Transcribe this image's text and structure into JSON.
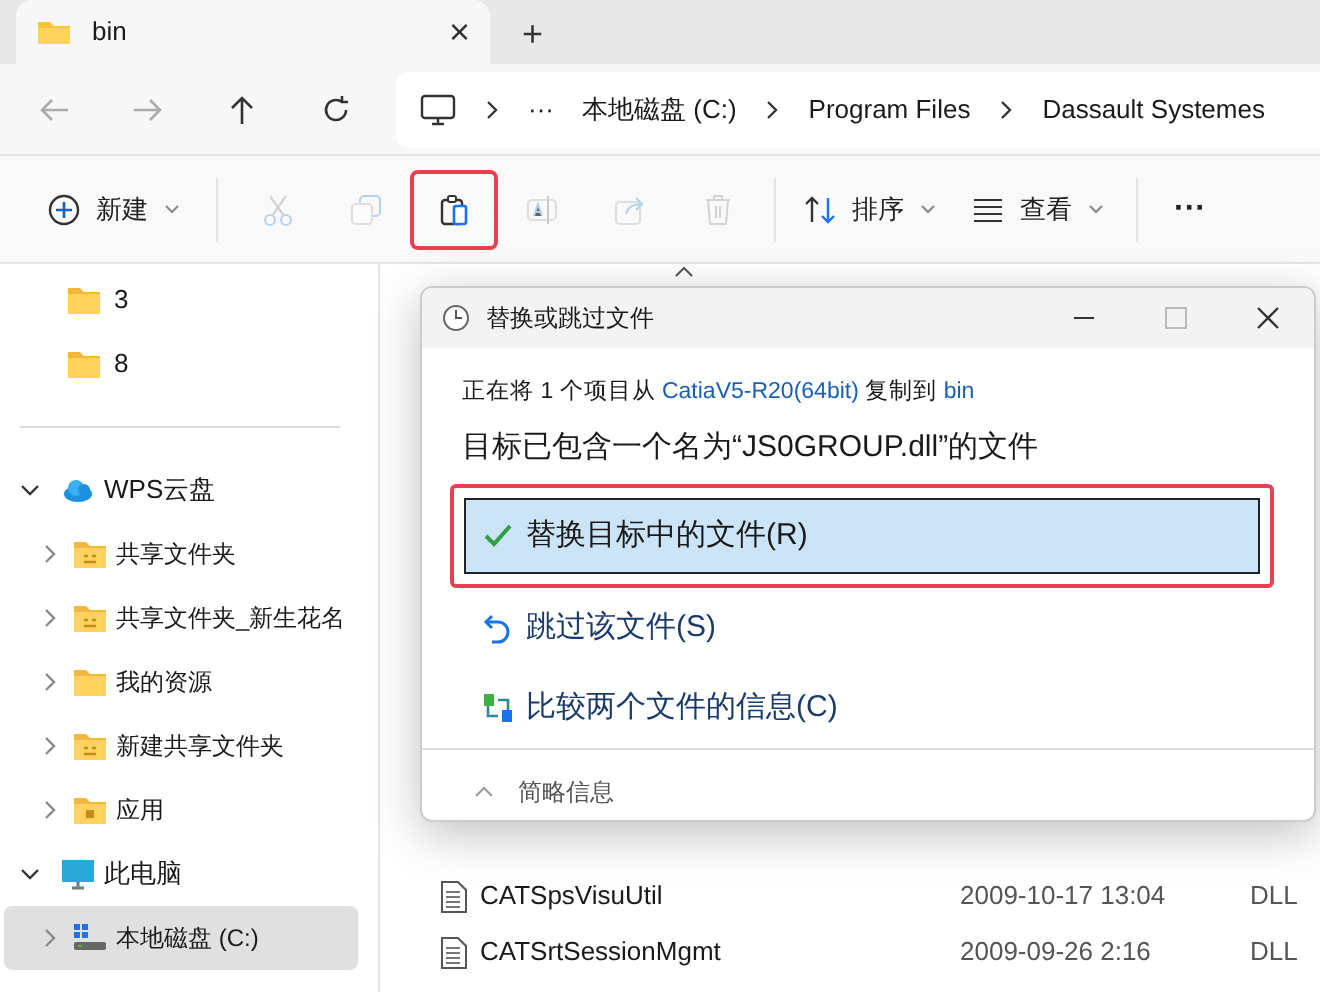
{
  "tab": {
    "title": "bin",
    "close": "×",
    "new_tab": "+"
  },
  "address": {
    "overflow": "···",
    "crumbs": [
      "本地磁盘 (C:)",
      "Program Files",
      "Dassault Systemes"
    ]
  },
  "toolbar": [
    {
      "kind": "new",
      "label": "新建",
      "disabled": false,
      "highlighted": false
    },
    {
      "kind": "cut",
      "disabled": true,
      "highlighted": false
    },
    {
      "kind": "copy",
      "disabled": true,
      "highlighted": false
    },
    {
      "kind": "paste",
      "disabled": false,
      "highlighted": true
    },
    {
      "kind": "rename",
      "disabled": true,
      "highlighted": false
    },
    {
      "kind": "share",
      "disabled": true,
      "highlighted": false
    },
    {
      "kind": "delete",
      "disabled": true,
      "highlighted": false
    },
    {
      "kind": "sort",
      "label": "排序",
      "disabled": false,
      "highlighted": false
    },
    {
      "kind": "view",
      "label": "查看",
      "disabled": false,
      "highlighted": false
    },
    {
      "kind": "more",
      "label": "···",
      "disabled": false,
      "highlighted": false
    }
  ],
  "sidebar": {
    "top_items": [
      {
        "label": "3"
      },
      {
        "label": "8"
      }
    ],
    "groups": [
      {
        "kind": "cloud",
        "label": "WPS云盘",
        "expanded": true,
        "children": [
          {
            "kind": "shared",
            "label": "共享文件夹",
            "selected": false
          },
          {
            "kind": "shared",
            "label": "共享文件夹_新生花名",
            "selected": false
          },
          {
            "kind": "folder",
            "label": "我的资源",
            "selected": false
          },
          {
            "kind": "shared",
            "label": "新建共享文件夹",
            "selected": false
          },
          {
            "kind": "apps",
            "label": "应用",
            "selected": false
          }
        ]
      },
      {
        "kind": "pc",
        "label": "此电脑",
        "expanded": true,
        "children": [
          {
            "kind": "drive",
            "label": "本地磁盘 (C:)",
            "selected": true
          }
        ]
      }
    ]
  },
  "files": [
    {
      "name": "CATSpsVisuUtil",
      "date": "2009-10-17 13:04",
      "type": "DLL"
    },
    {
      "name": "CATSrtSessionMgmt",
      "date": "2009-09-26 2:16",
      "type": "DLL"
    }
  ],
  "dialog": {
    "title": "替换或跳过文件",
    "source_prefix": "正在将 1 个项目从 ",
    "source": "CatiaV5-R20(64bit)",
    "source_middle": " 复制到 ",
    "destination": "bin",
    "heading": "目标已包含一个名为“JS0GROUP.dll”的文件",
    "options": [
      {
        "kind": "replace",
        "label": "替换目标中的文件(R)",
        "selected": true,
        "highlighted": true
      },
      {
        "kind": "skip",
        "label": "跳过该文件(S)",
        "selected": false,
        "highlighted": false
      },
      {
        "kind": "compare",
        "label": "比较两个文件的信息(C)",
        "selected": false,
        "highlighted": false
      }
    ],
    "details": "简略信息"
  }
}
